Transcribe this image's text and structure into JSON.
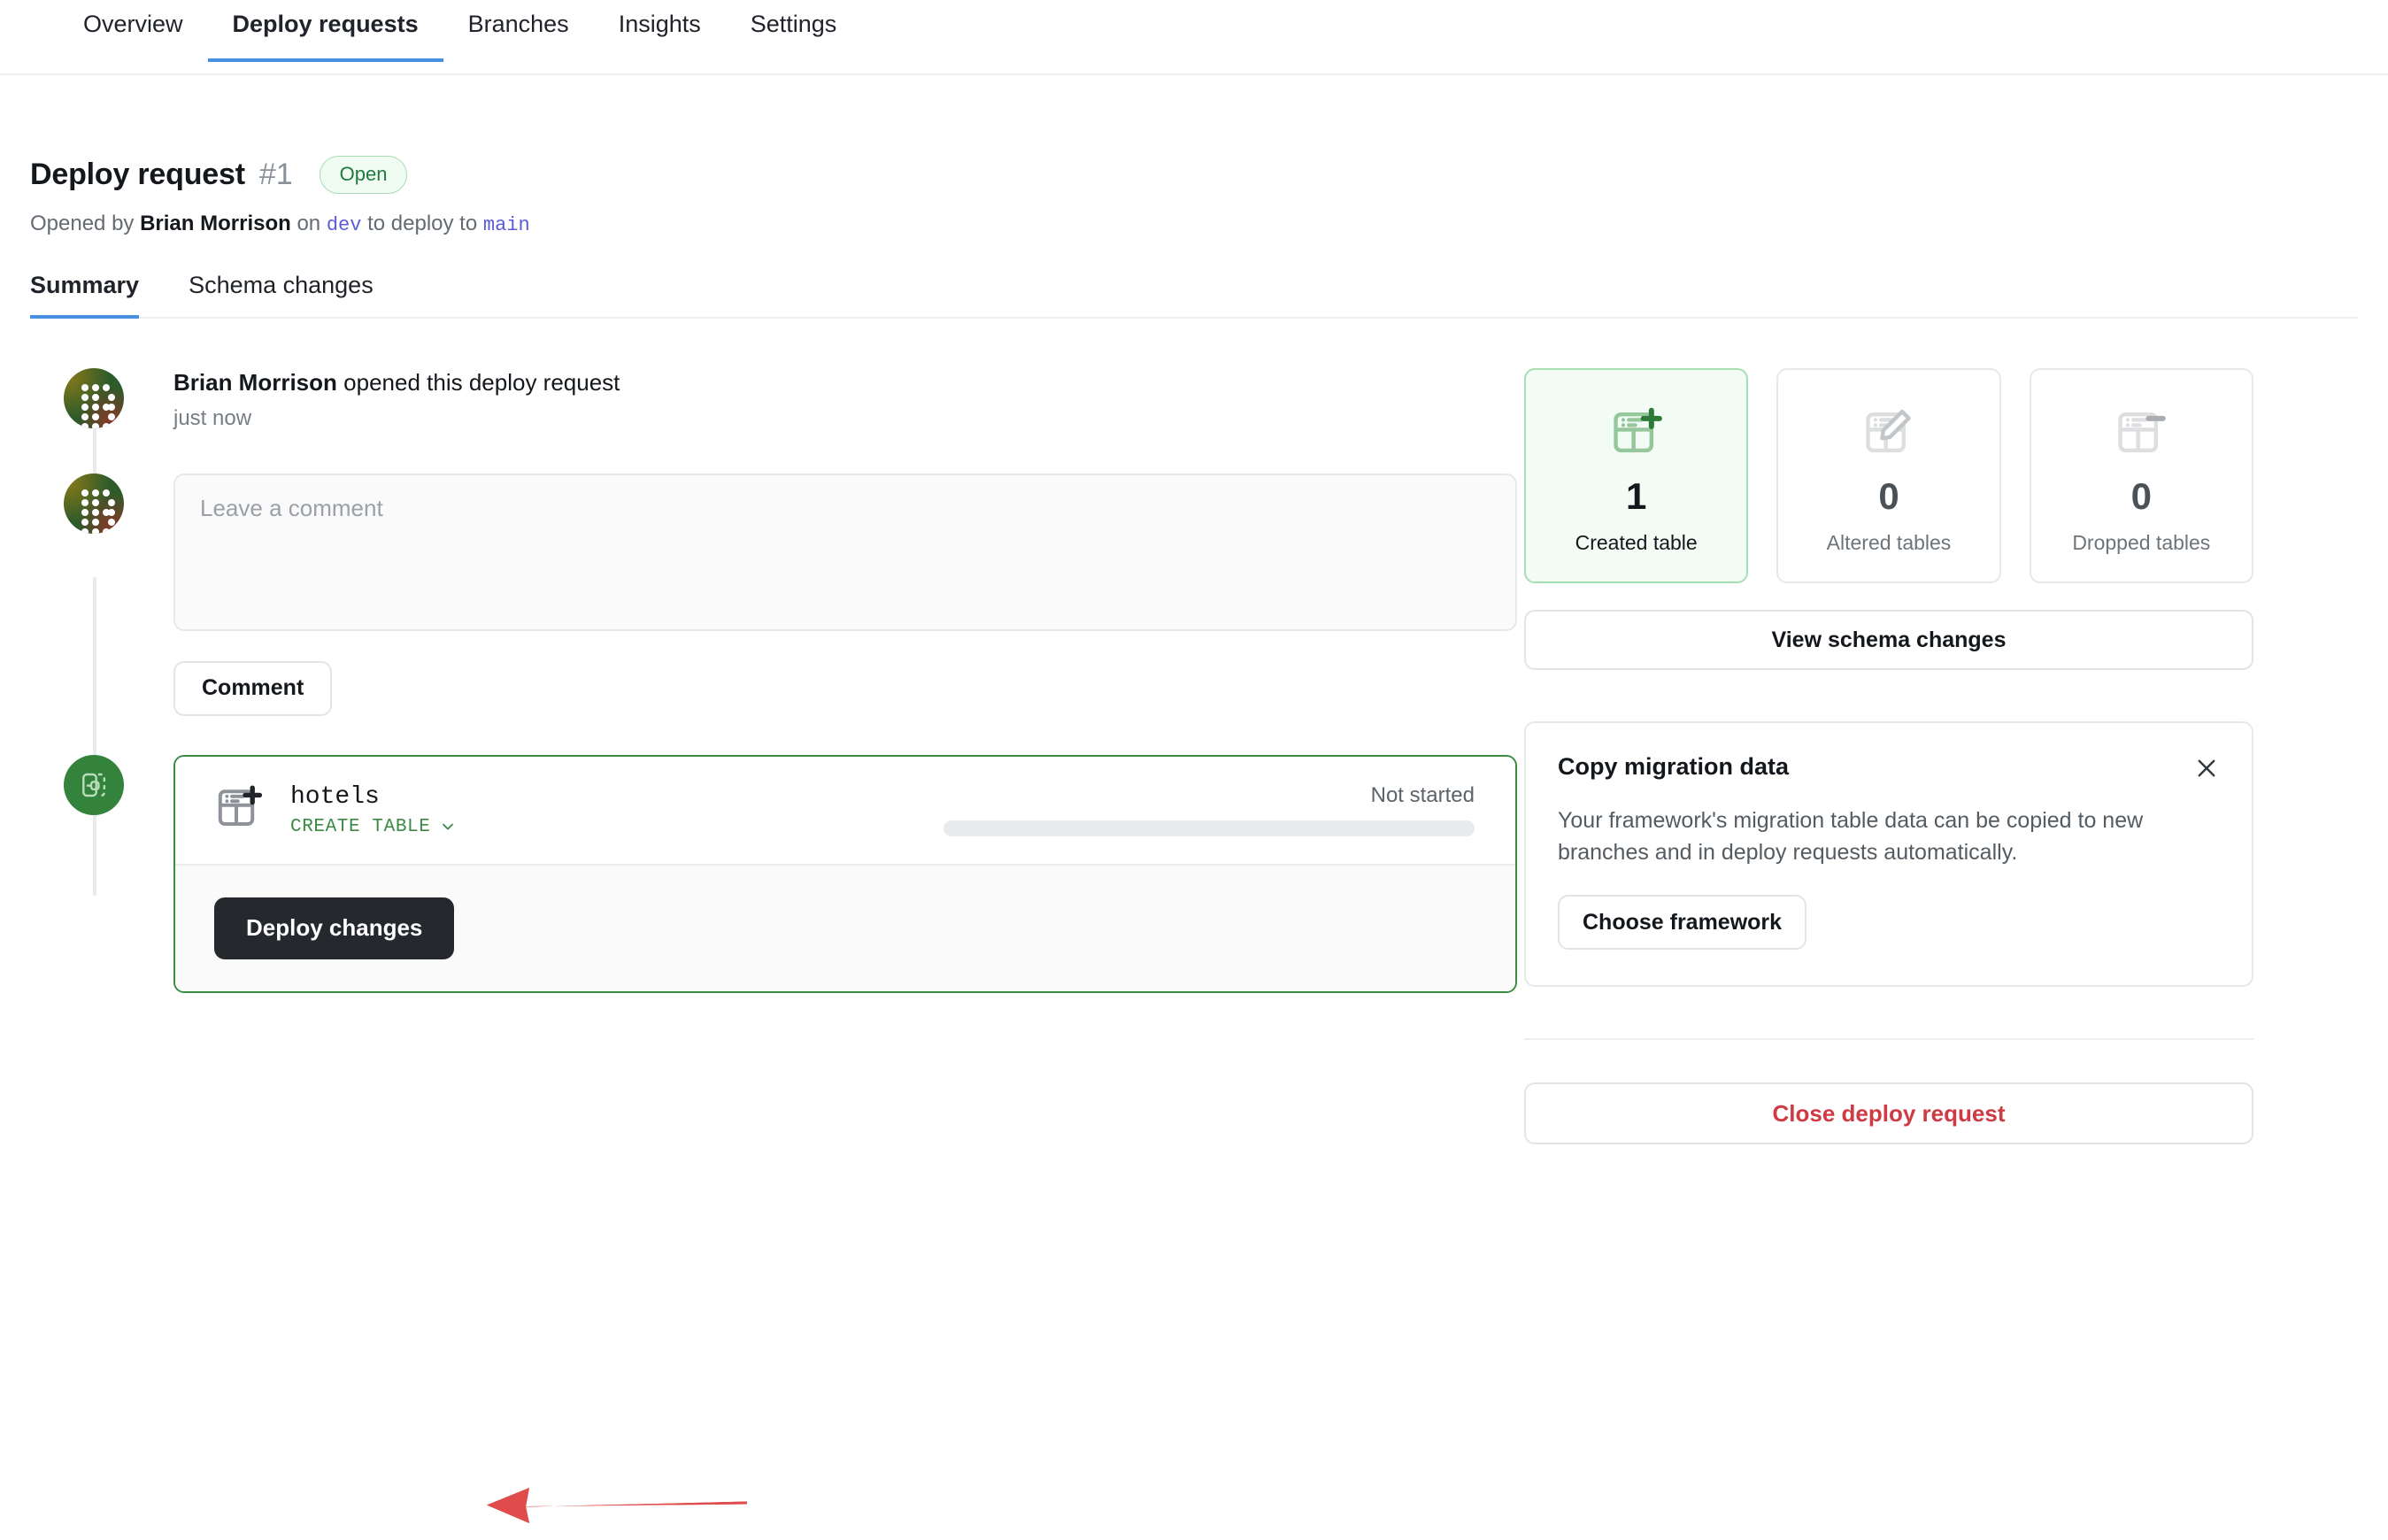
{
  "nav": {
    "tabs": [
      {
        "label": "Overview",
        "active": false
      },
      {
        "label": "Deploy requests",
        "active": true
      },
      {
        "label": "Branches",
        "active": false
      },
      {
        "label": "Insights",
        "active": false
      },
      {
        "label": "Settings",
        "active": false
      }
    ]
  },
  "header": {
    "title": "Deploy request",
    "number": "#1",
    "status": "Open",
    "opened_by_prefix": "Opened by",
    "author": "Brian Morrison",
    "on_word": "on",
    "source_branch": "dev",
    "deploy_to_text": "to deploy to",
    "target_branch": "main"
  },
  "subtabs": [
    {
      "label": "Summary",
      "active": true
    },
    {
      "label": "Schema changes",
      "active": false
    }
  ],
  "timeline": {
    "event": {
      "author": "Brian Morrison",
      "action": "opened this deploy request",
      "time": "just now"
    },
    "comment": {
      "placeholder": "Leave a comment",
      "value": "",
      "submit_label": "Comment"
    },
    "deploy": {
      "table_name": "hotels",
      "operation": "CREATE TABLE",
      "status": "Not started",
      "progress_percent": 0,
      "deploy_button_label": "Deploy changes"
    }
  },
  "sidebar": {
    "stats": [
      {
        "count": "1",
        "label": "Created table",
        "icon": "create-table-icon",
        "highlight": true
      },
      {
        "count": "0",
        "label": "Altered tables",
        "icon": "alter-table-icon",
        "highlight": false
      },
      {
        "count": "0",
        "label": "Dropped tables",
        "icon": "drop-table-icon",
        "highlight": false
      }
    ],
    "view_schema_label": "View schema changes",
    "migration_card": {
      "title": "Copy migration data",
      "body": "Your framework's migration table data can be copied to new branches and in deploy requests automatically.",
      "action_label": "Choose framework"
    },
    "close_request_label": "Close deploy request"
  },
  "annotation": {
    "arrow_color": "#e04b4b",
    "points_to": "Deploy changes"
  },
  "colors": {
    "accent_blue": "#4a90e2",
    "success_green": "#3a8c42",
    "danger_red": "#cf3b44",
    "branch_link": "#5b5bd6",
    "deploy_button_bg": "#25282c"
  }
}
